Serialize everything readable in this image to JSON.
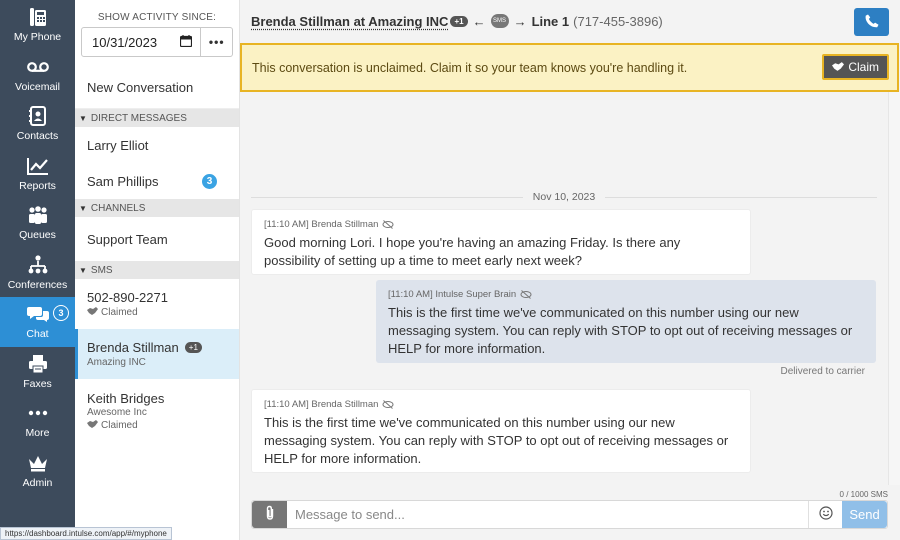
{
  "nav": {
    "items": [
      {
        "label": "My Phone",
        "icon": "desk-phone-icon"
      },
      {
        "label": "Voicemail",
        "icon": "voicemail-icon"
      },
      {
        "label": "Contacts",
        "icon": "contacts-book-icon"
      },
      {
        "label": "Reports",
        "icon": "line-chart-icon"
      },
      {
        "label": "Queues",
        "icon": "people-group-icon"
      },
      {
        "label": "Conferences",
        "icon": "org-chart-icon"
      },
      {
        "label": "Chat",
        "icon": "chat-bubbles-icon",
        "badge": "3",
        "active": true
      },
      {
        "label": "Faxes",
        "icon": "printer-icon"
      },
      {
        "label": "More",
        "icon": "ellipsis-icon"
      },
      {
        "label": "Admin",
        "icon": "crown-icon"
      }
    ]
  },
  "list": {
    "since_label": "SHOW ACTIVITY SINCE:",
    "since_date": "10/31/2023",
    "more_label": "•••",
    "new_conversation": "New Conversation",
    "sections": {
      "direct": "DIRECT MESSAGES",
      "channels": "CHANNELS",
      "sms": "SMS"
    },
    "direct": [
      {
        "name": "Larry Elliot"
      },
      {
        "name": "Sam Phillips",
        "badge": "3"
      }
    ],
    "channels": [
      {
        "name": "Support Team"
      }
    ],
    "sms": [
      {
        "name": "502-890-2271",
        "status": "Claimed"
      },
      {
        "name": "Brenda Stillman",
        "plus": "+1",
        "company": "Amazing INC"
      },
      {
        "name": "Keith Bridges",
        "company": "Awesome Inc",
        "status": "Claimed"
      }
    ]
  },
  "status_url": "https://dashboard.intulse.com/app/#/myphone",
  "header": {
    "contact": "Brenda Stillman at Amazing INC",
    "plus": "+1",
    "sms_tag": "SMS",
    "line": "Line 1",
    "number": "(717-455-3896)",
    "left_arrow": "←",
    "right_arrow": "→"
  },
  "banner": {
    "text": "This conversation is unclaimed. Claim it so your team knows you're handling it.",
    "claim_label": "Claim"
  },
  "thread": {
    "date": "Nov 10, 2023",
    "messages": [
      {
        "direction": "in",
        "meta": "[11:10 AM] Brenda Stillman",
        "body": "Good morning Lori. I hope you're having an amazing Friday. Is there any possibility of setting up a time to meet early next week?"
      },
      {
        "direction": "out",
        "meta": "[11:10 AM] Intulse Super Brain",
        "body": "This is the first time we've communicated on this number using our new messaging system. You can reply with STOP to opt out of receiving messages or HELP for more information.",
        "delivery": "Delivered to carrier"
      },
      {
        "direction": "in",
        "meta": "[11:10 AM] Brenda Stillman",
        "body": "This is the first time we've communicated on this number using our new messaging system. You can reply with STOP to opt out of receiving messages or HELP for more information."
      }
    ]
  },
  "composer": {
    "placeholder": "Message to send...",
    "counter": "0 / 1000 SMS",
    "send_label": "Send"
  }
}
